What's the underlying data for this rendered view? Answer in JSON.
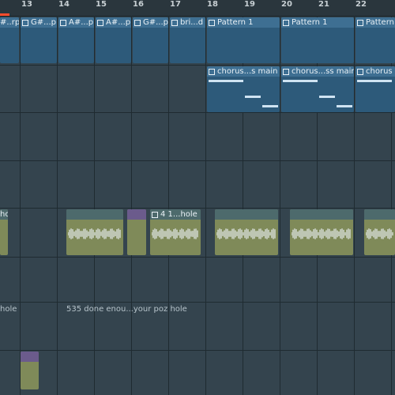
{
  "ruler": {
    "bars": [
      "13",
      "14",
      "15",
      "16",
      "17",
      "18",
      "19",
      "20",
      "21",
      "22"
    ]
  },
  "track1": {
    "clips": [
      {
        "label": "#..rp"
      },
      {
        "label": "G#...p"
      },
      {
        "label": "A#...p"
      },
      {
        "label": "A#...p"
      },
      {
        "label": "G#...p"
      },
      {
        "label": "bri...d"
      },
      {
        "label": "Pattern 1"
      },
      {
        "label": "Pattern 1"
      },
      {
        "label": "Pattern 1"
      }
    ]
  },
  "track2": {
    "clips": [
      {
        "label": "chorus...s main"
      },
      {
        "label": "chorus...ss main"
      },
      {
        "label": "chorus"
      }
    ]
  },
  "track3": {
    "clips": [
      {
        "label": "hole"
      },
      {
        "label": ""
      },
      {
        "label": ""
      },
      {
        "label": ""
      },
      {
        "label": ""
      },
      {
        "label": "4 1...hole"
      },
      {
        "label": ""
      },
      {
        "label": ""
      },
      {
        "label": ""
      }
    ]
  },
  "track4": {
    "label_left": "hole",
    "clip_label": "535 done enou...your poz hole"
  },
  "track5": {
    "clip_label": ""
  },
  "colors": {
    "pattern": "#3e6f92",
    "audio": "#7f8a59",
    "audio_head": "#4d6a6c",
    "audio_head_purple": "#6b5b8c",
    "playhead": "#ff4d2e"
  }
}
